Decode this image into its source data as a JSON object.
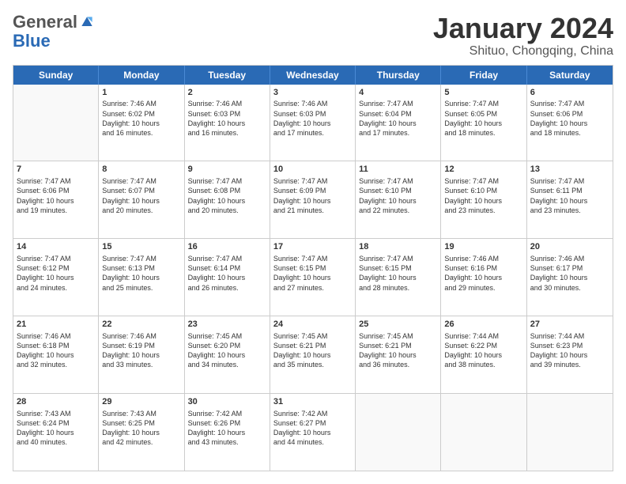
{
  "logo": {
    "general": "General",
    "blue": "Blue"
  },
  "header": {
    "month": "January 2024",
    "location": "Shituo, Chongqing, China"
  },
  "days": [
    "Sunday",
    "Monday",
    "Tuesday",
    "Wednesday",
    "Thursday",
    "Friday",
    "Saturday"
  ],
  "weeks": [
    [
      {
        "day": "",
        "empty": true
      },
      {
        "day": "1",
        "sunrise": "Sunrise: 7:46 AM",
        "sunset": "Sunset: 6:02 PM",
        "daylight": "Daylight: 10 hours and 16 minutes."
      },
      {
        "day": "2",
        "sunrise": "Sunrise: 7:46 AM",
        "sunset": "Sunset: 6:03 PM",
        "daylight": "Daylight: 10 hours and 16 minutes."
      },
      {
        "day": "3",
        "sunrise": "Sunrise: 7:46 AM",
        "sunset": "Sunset: 6:03 PM",
        "daylight": "Daylight: 10 hours and 17 minutes."
      },
      {
        "day": "4",
        "sunrise": "Sunrise: 7:47 AM",
        "sunset": "Sunset: 6:04 PM",
        "daylight": "Daylight: 10 hours and 17 minutes."
      },
      {
        "day": "5",
        "sunrise": "Sunrise: 7:47 AM",
        "sunset": "Sunset: 6:05 PM",
        "daylight": "Daylight: 10 hours and 18 minutes."
      },
      {
        "day": "6",
        "sunrise": "Sunrise: 7:47 AM",
        "sunset": "Sunset: 6:06 PM",
        "daylight": "Daylight: 10 hours and 18 minutes."
      }
    ],
    [
      {
        "day": "7",
        "sunrise": "Sunrise: 7:47 AM",
        "sunset": "Sunset: 6:06 PM",
        "daylight": "Daylight: 10 hours and 19 minutes."
      },
      {
        "day": "8",
        "sunrise": "Sunrise: 7:47 AM",
        "sunset": "Sunset: 6:07 PM",
        "daylight": "Daylight: 10 hours and 20 minutes."
      },
      {
        "day": "9",
        "sunrise": "Sunrise: 7:47 AM",
        "sunset": "Sunset: 6:08 PM",
        "daylight": "Daylight: 10 hours and 20 minutes."
      },
      {
        "day": "10",
        "sunrise": "Sunrise: 7:47 AM",
        "sunset": "Sunset: 6:09 PM",
        "daylight": "Daylight: 10 hours and 21 minutes."
      },
      {
        "day": "11",
        "sunrise": "Sunrise: 7:47 AM",
        "sunset": "Sunset: 6:10 PM",
        "daylight": "Daylight: 10 hours and 22 minutes."
      },
      {
        "day": "12",
        "sunrise": "Sunrise: 7:47 AM",
        "sunset": "Sunset: 6:10 PM",
        "daylight": "Daylight: 10 hours and 23 minutes."
      },
      {
        "day": "13",
        "sunrise": "Sunrise: 7:47 AM",
        "sunset": "Sunset: 6:11 PM",
        "daylight": "Daylight: 10 hours and 23 minutes."
      }
    ],
    [
      {
        "day": "14",
        "sunrise": "Sunrise: 7:47 AM",
        "sunset": "Sunset: 6:12 PM",
        "daylight": "Daylight: 10 hours and 24 minutes."
      },
      {
        "day": "15",
        "sunrise": "Sunrise: 7:47 AM",
        "sunset": "Sunset: 6:13 PM",
        "daylight": "Daylight: 10 hours and 25 minutes."
      },
      {
        "day": "16",
        "sunrise": "Sunrise: 7:47 AM",
        "sunset": "Sunset: 6:14 PM",
        "daylight": "Daylight: 10 hours and 26 minutes."
      },
      {
        "day": "17",
        "sunrise": "Sunrise: 7:47 AM",
        "sunset": "Sunset: 6:15 PM",
        "daylight": "Daylight: 10 hours and 27 minutes."
      },
      {
        "day": "18",
        "sunrise": "Sunrise: 7:47 AM",
        "sunset": "Sunset: 6:15 PM",
        "daylight": "Daylight: 10 hours and 28 minutes."
      },
      {
        "day": "19",
        "sunrise": "Sunrise: 7:46 AM",
        "sunset": "Sunset: 6:16 PM",
        "daylight": "Daylight: 10 hours and 29 minutes."
      },
      {
        "day": "20",
        "sunrise": "Sunrise: 7:46 AM",
        "sunset": "Sunset: 6:17 PM",
        "daylight": "Daylight: 10 hours and 30 minutes."
      }
    ],
    [
      {
        "day": "21",
        "sunrise": "Sunrise: 7:46 AM",
        "sunset": "Sunset: 6:18 PM",
        "daylight": "Daylight: 10 hours and 32 minutes."
      },
      {
        "day": "22",
        "sunrise": "Sunrise: 7:46 AM",
        "sunset": "Sunset: 6:19 PM",
        "daylight": "Daylight: 10 hours and 33 minutes."
      },
      {
        "day": "23",
        "sunrise": "Sunrise: 7:45 AM",
        "sunset": "Sunset: 6:20 PM",
        "daylight": "Daylight: 10 hours and 34 minutes."
      },
      {
        "day": "24",
        "sunrise": "Sunrise: 7:45 AM",
        "sunset": "Sunset: 6:21 PM",
        "daylight": "Daylight: 10 hours and 35 minutes."
      },
      {
        "day": "25",
        "sunrise": "Sunrise: 7:45 AM",
        "sunset": "Sunset: 6:21 PM",
        "daylight": "Daylight: 10 hours and 36 minutes."
      },
      {
        "day": "26",
        "sunrise": "Sunrise: 7:44 AM",
        "sunset": "Sunset: 6:22 PM",
        "daylight": "Daylight: 10 hours and 38 minutes."
      },
      {
        "day": "27",
        "sunrise": "Sunrise: 7:44 AM",
        "sunset": "Sunset: 6:23 PM",
        "daylight": "Daylight: 10 hours and 39 minutes."
      }
    ],
    [
      {
        "day": "28",
        "sunrise": "Sunrise: 7:43 AM",
        "sunset": "Sunset: 6:24 PM",
        "daylight": "Daylight: 10 hours and 40 minutes."
      },
      {
        "day": "29",
        "sunrise": "Sunrise: 7:43 AM",
        "sunset": "Sunset: 6:25 PM",
        "daylight": "Daylight: 10 hours and 42 minutes."
      },
      {
        "day": "30",
        "sunrise": "Sunrise: 7:42 AM",
        "sunset": "Sunset: 6:26 PM",
        "daylight": "Daylight: 10 hours and 43 minutes."
      },
      {
        "day": "31",
        "sunrise": "Sunrise: 7:42 AM",
        "sunset": "Sunset: 6:27 PM",
        "daylight": "Daylight: 10 hours and 44 minutes."
      },
      {
        "day": "",
        "empty": true
      },
      {
        "day": "",
        "empty": true
      },
      {
        "day": "",
        "empty": true
      }
    ]
  ]
}
